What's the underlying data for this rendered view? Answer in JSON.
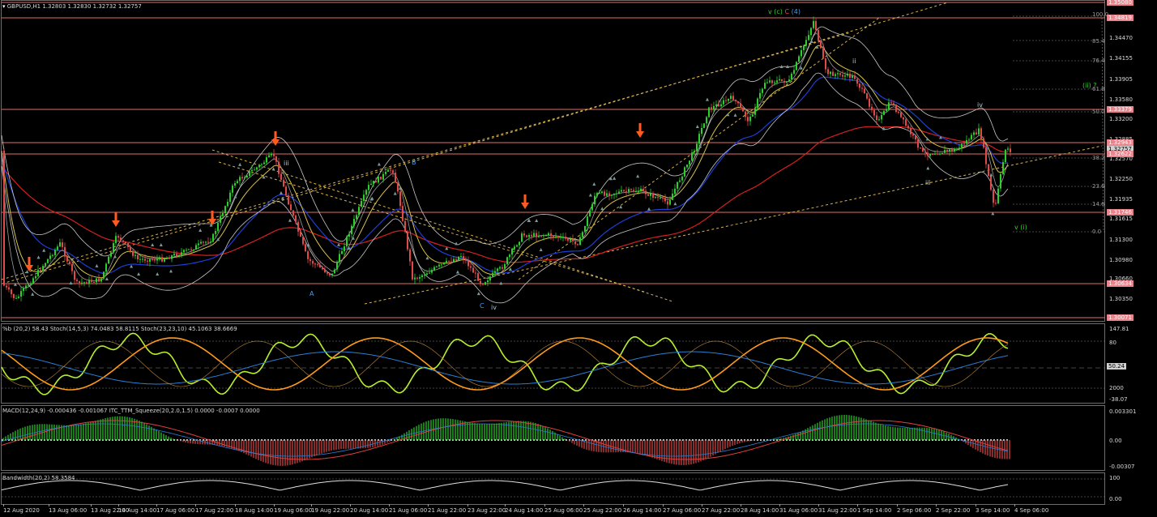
{
  "header": {
    "text": "GBPUSD,H1  1.32803 1.32830 1.32732 1.32757"
  },
  "colors": {
    "bull_candle": "#2bd12b",
    "bear_candle": "#e04a4a",
    "sma_blue": "#1d3fd6",
    "sma_red": "#d42020",
    "ema_yellow": "#d8c34a",
    "ema_white": "#e0e0e0",
    "bollinger": "#c8c8c8",
    "hline": "#e0706a",
    "arrow": "#ff5a1f",
    "stoch_main": "#b8f02a",
    "stoch_signal": "#ff9a1a",
    "macd_hist_pos": "#2bd12b",
    "macd_hist_neg": "#e04a4a",
    "channel": "#d8b24a"
  },
  "price_axis": {
    "ticks": [
      "1.34470",
      "1.34155",
      "1.33905",
      "1.33580",
      "1.33200",
      "1.32885",
      "1.32570",
      "1.32250",
      "1.31935",
      "1.31615",
      "1.31300",
      "1.30980",
      "1.30660",
      "1.30350"
    ],
    "boxes": [
      {
        "text": "1.35080",
        "style": "level"
      },
      {
        "text": "1.34819",
        "style": "level"
      },
      {
        "text": "1.33379",
        "style": "level"
      },
      {
        "text": "1.32943",
        "style": "level"
      },
      {
        "text": "1.32757",
        "style": "current"
      },
      {
        "text": "1.32622",
        "style": "level"
      },
      {
        "text": "1.31746",
        "style": "level"
      },
      {
        "text": "1.30634",
        "style": "level"
      },
      {
        "text": "1.30071",
        "style": "level"
      }
    ]
  },
  "fib_levels": [
    "100.0",
    "85.4",
    "76.4",
    "61.8",
    "50.0",
    "38.2",
    "23.6",
    "14.6",
    "0.0"
  ],
  "wave_labels": {
    "top": [
      {
        "text": "v",
        "color": "#2bd12b"
      },
      {
        "text": "(c)",
        "color": "#2bd12b"
      },
      {
        "text": "C",
        "color": "#e04a4a"
      },
      {
        "text": "(4)",
        "color": "#3aa0ff"
      }
    ],
    "others": [
      {
        "id": "w-iii-left",
        "text": "iii",
        "color": "#9bd0e8"
      },
      {
        "id": "w-B",
        "text": "B",
        "color": "#3aa0ff"
      },
      {
        "id": "w-A",
        "text": "A",
        "color": "#3aa0ff"
      },
      {
        "id": "w-C",
        "text": "C",
        "color": "#3aa0ff"
      },
      {
        "id": "w-iv",
        "text": "iv",
        "color": "#9bd0e8"
      },
      {
        "id": "w-ii",
        "text": "ii",
        "color": "#9bd0e8"
      },
      {
        "id": "w-iii-right",
        "text": "iii",
        "color": "#9bd0e8"
      },
      {
        "id": "w-iv-right",
        "text": "iv",
        "color": "#9bd0e8"
      },
      {
        "id": "w-ii-q",
        "text": "(ii) ?",
        "color": "#2bd12b"
      },
      {
        "id": "w-v-i",
        "text": "v (i)",
        "color": "#2bd12b"
      }
    ]
  },
  "stoch_pane": {
    "title": "%b (20,2) 58.43  Stoch(14,5,3) 74.0483 58.8115  Stoch(23,23,10) 45.1063 38.6669",
    "axis": {
      "top": "147.81",
      "l80": "80",
      "cur": "50.24",
      "l20": "2000",
      "bottom": "-38.07"
    }
  },
  "macd_pane": {
    "title": "MACD(12,24,9) -0.000436 -0.001067  ITC_TTM_Squeeze(20,2.0,1.5) 0.0000 -0.0007 0.0000",
    "axis": {
      "top": "0.003301",
      "mid": "0.00",
      "bottom": "-0.00307"
    }
  },
  "bandwidth_pane": {
    "title": "Bandwidth(20,2) 58.3584",
    "axis": {
      "top": "100",
      "bottom": "0.00"
    }
  },
  "time_axis": [
    "12 Aug 2020",
    "13 Aug 06:00",
    "13 Aug 22:00",
    "14 Aug 14:00",
    "17 Aug 06:00",
    "17 Aug 22:00",
    "18 Aug 14:00",
    "19 Aug 06:00",
    "19 Aug 22:00",
    "20 Aug 14:00",
    "21 Aug 06:00",
    "21 Aug 22:00",
    "23 Aug 22:00",
    "24 Aug 14:00",
    "25 Aug 06:00",
    "25 Aug 22:00",
    "26 Aug 14:00",
    "27 Aug 06:00",
    "27 Aug 22:00",
    "28 Aug 14:00",
    "31 Aug 06:00",
    "31 Aug 22:00",
    "1 Sep 14:00",
    "2 Sep 06:00",
    "2 Sep 22:00",
    "3 Sep 14:00",
    "4 Sep 06:00"
  ]
}
